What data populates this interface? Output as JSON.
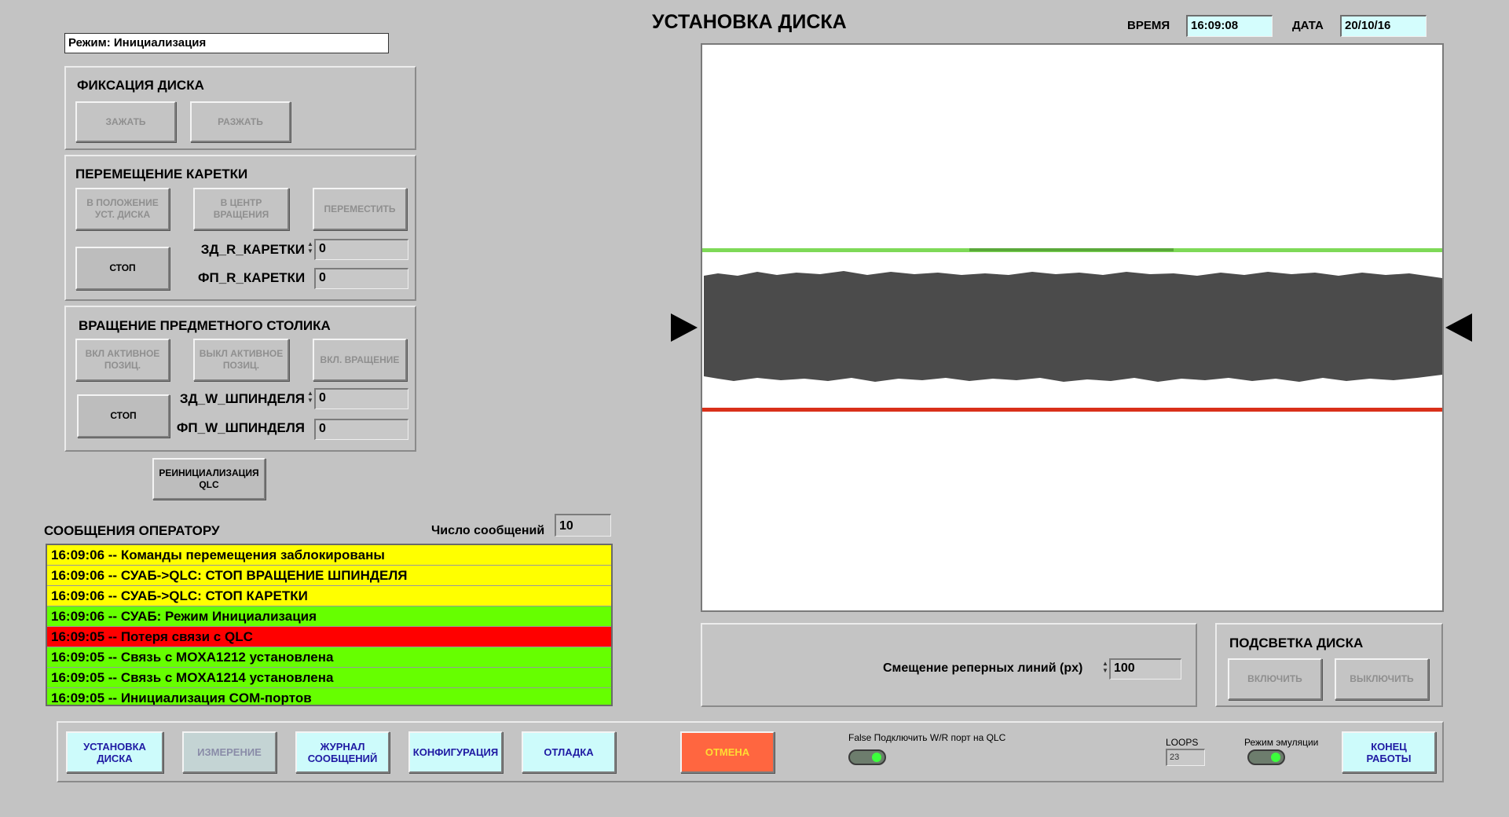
{
  "header": {
    "title": "УСТАНОВКА ДИСКА",
    "time_label": "ВРЕМЯ",
    "time_value": "16:09:08",
    "date_label": "ДАТА",
    "date_value": "20/10/16"
  },
  "mode": {
    "value": "Режим: Инициализация"
  },
  "disk_fix": {
    "title": "ФИКСАЦИЯ ДИСКА",
    "clamp": "ЗАЖАТЬ",
    "release": "РАЗЖАТЬ"
  },
  "carriage": {
    "title": "ПЕРЕМЕЩЕНИЕ КАРЕТКИ",
    "to_disk_position": "В ПОЛОЖЕНИЕ УСТ. ДИСКА",
    "to_rotation_center": "В ЦЕНТР ВРАЩЕНИЯ",
    "move": "ПЕРЕМЕСТИТЬ",
    "stop": "СТОП",
    "set_label": "ЗД_R_КАРЕТКИ",
    "set_value": "0",
    "actual_label": "ФП_R_КАРЕТКИ",
    "actual_value": "0"
  },
  "rotation": {
    "title": "ВРАЩЕНИЕ ПРЕДМЕТНОГО СТОЛИКА",
    "active_pos_on": "ВКЛ АКТИВНОЕ ПОЗИЦ.",
    "active_pos_off": "ВЫКЛ АКТИВНОЕ ПОЗИЦ.",
    "rotation_on": "ВКЛ. ВРАЩЕНИЕ",
    "stop": "СТОП",
    "set_label": "ЗД_W_ШПИНДЕЛЯ",
    "set_value": "0",
    "actual_label": "ФП_W_ШПИНДЕЛЯ",
    "actual_value": "0"
  },
  "reinit_button": "РЕИНИЦИАЛИЗАЦИЯ QLC",
  "messages": {
    "title": "СООБЩЕНИЯ ОПЕРАТОРУ",
    "count_label": "Число сообщений",
    "count_value": "10",
    "items": [
      {
        "text": "16:09:06  --  Команды перемещения заблокированы",
        "color": "#ffff00"
      },
      {
        "text": "16:09:06  --  СУАБ->QLC: СТОП ВРАЩЕНИЕ ШПИНДЕЛЯ",
        "color": "#ffff00"
      },
      {
        "text": "16:09:06  --  СУАБ->QLC:  СТОП КАРЕТКИ",
        "color": "#ffff00"
      },
      {
        "text": "16:09:06  --  СУАБ: Режим Инициализация",
        "color": "#66ff00"
      },
      {
        "text": "16:09:05  --  Потеря связи с QLC",
        "color": "#ff0000"
      },
      {
        "text": "16:09:05  --  Связь с MOXA1212 установлена",
        "color": "#66ff00"
      },
      {
        "text": "16:09:05  --  Связь с MOXA1214 установлена",
        "color": "#66ff00"
      },
      {
        "text": "16:09:05  --  Инициализация COM-портов",
        "color": "#66ff00"
      }
    ]
  },
  "offset": {
    "label": "Смещение реперных линий (px)",
    "value": "100"
  },
  "backlight": {
    "title": "ПОДСВЕТКА ДИСКА",
    "on": "ВКЛЮЧИТЬ",
    "off": "ВЫКЛЮЧИТЬ"
  },
  "bottom": {
    "install_disk": "УСТАНОВКА ДИСКА",
    "measure": "ИЗМЕРЕНИЕ",
    "message_log": "ЖУРНАЛ СООБЩЕНИЙ",
    "configuration": "КОНФИГУРАЦИЯ",
    "debug": "ОТЛАДКА",
    "cancel": "ОТМЕНА",
    "connect_label": "False Подключить W/R порт на QLC",
    "loops_label": "LOOPS",
    "loops_value": "23",
    "emulation_label": "Режим эмуляции",
    "end_work": "КОНЕЦ РАБОТЫ"
  },
  "colors": {
    "upper_reference_line": "#7ed957",
    "lower_reference_line": "#d9301a",
    "disk_shadow": "#4b4b4b"
  }
}
